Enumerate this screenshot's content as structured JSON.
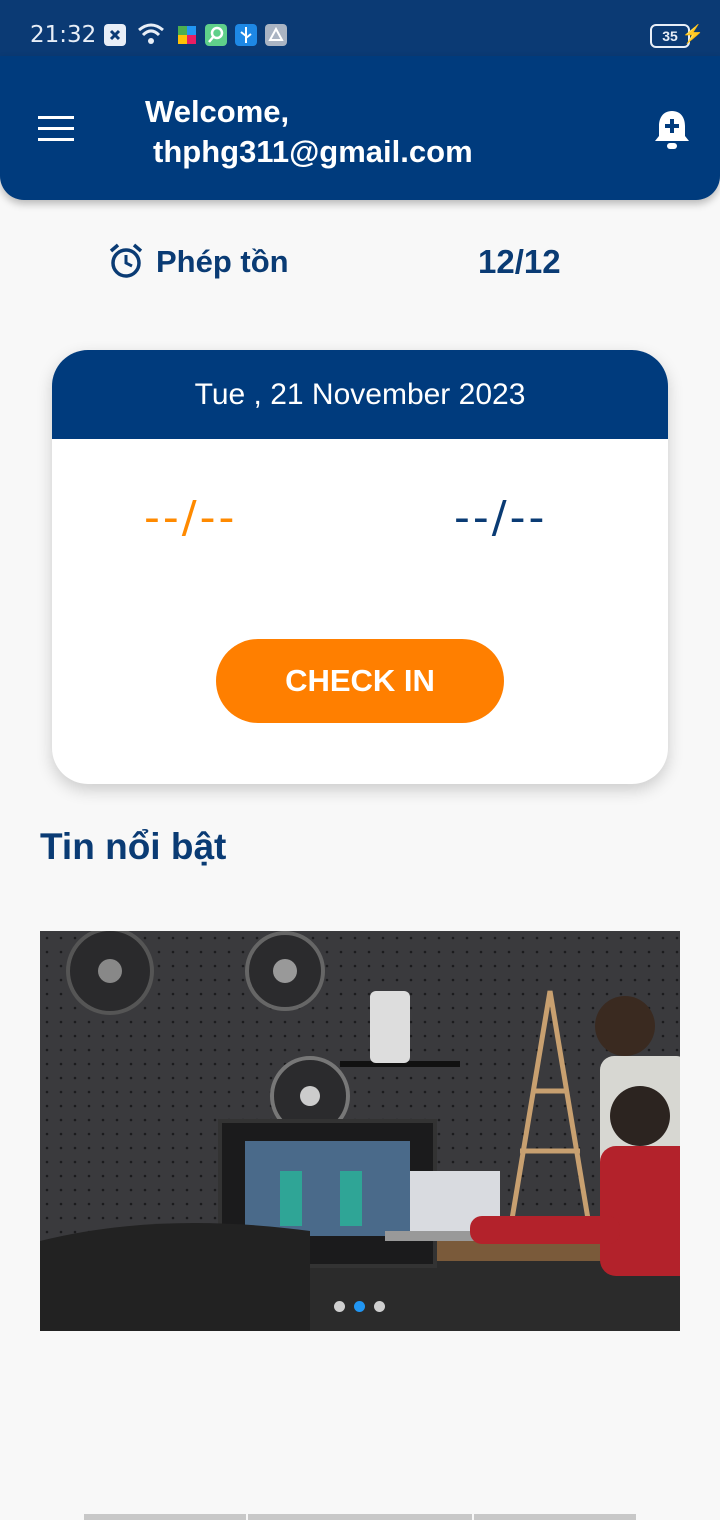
{
  "status_bar": {
    "time": "21:32",
    "battery": "35"
  },
  "header": {
    "welcome": "Welcome,",
    "email": "thphg311@gmail.com"
  },
  "leave": {
    "label": "Phép tồn",
    "value": "12/12"
  },
  "card": {
    "date": "Tue , 21 November 2023",
    "time_in": "--/--",
    "time_out": "--/--",
    "button_label": "CHECK IN"
  },
  "news": {
    "section_title": "Tin nổi bật",
    "slides": 3,
    "active_slide": 2
  },
  "colors": {
    "primary": "#003b7d",
    "accent": "#ff7f00",
    "text_dark": "#0a3b74",
    "background": "#f8f8f8"
  }
}
